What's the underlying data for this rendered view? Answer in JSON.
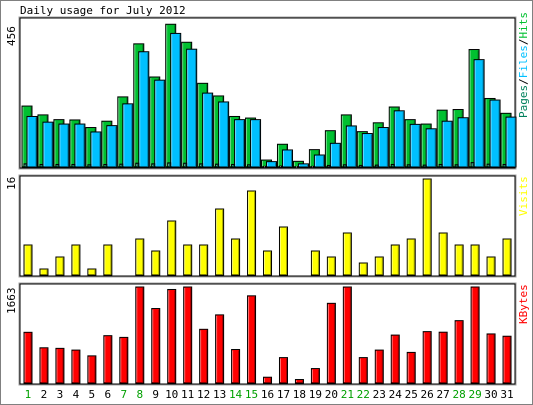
{
  "chart_data": [
    {
      "type": "bar",
      "title": "Daily usage for July 2012",
      "categories": [
        "1",
        "2",
        "3",
        "4",
        "5",
        "6",
        "7",
        "8",
        "9",
        "10",
        "11",
        "12",
        "13",
        "14",
        "15",
        "16",
        "17",
        "18",
        "19",
        "20",
        "21",
        "22",
        "23",
        "24",
        "25",
        "26",
        "27",
        "28",
        "29",
        "30",
        "31"
      ],
      "weekend_days": [
        "1",
        "7",
        "8",
        "14",
        "15",
        "21",
        "22",
        "28",
        "29"
      ],
      "ymax_label": "456",
      "ylim": [
        0,
        456
      ],
      "series": [
        {
          "name": "Pages",
          "color": "#00805c",
          "values": [
            10,
            8,
            8,
            8,
            7,
            8,
            9,
            12,
            10,
            13,
            12,
            10,
            9,
            8,
            7,
            2,
            3,
            1,
            2,
            5,
            7,
            5,
            6,
            8,
            7,
            6,
            8,
            7,
            14,
            9,
            8
          ]
        },
        {
          "name": "Files",
          "color": "#00c0ff",
          "values": [
            160,
            142,
            136,
            136,
            111,
            131,
            200,
            365,
            275,
            423,
            373,
            234,
            206,
            150,
            150,
            17,
            54,
            10,
            38,
            75,
            130,
            106,
            125,
            178,
            135,
            121,
            145,
            156,
            340,
            212,
            158
          ]
        },
        {
          "name": "Hits",
          "color": "#00c030",
          "values": [
            193,
            165,
            150,
            149,
            125,
            145,
            222,
            390,
            285,
            452,
            395,
            265,
            225,
            160,
            155,
            22,
            72,
            18,
            55,
            115,
            165,
            112,
            140,
            190,
            150,
            136,
            180,
            182,
            372,
            217,
            170
          ]
        }
      ]
    },
    {
      "type": "bar",
      "categories": [
        "1",
        "2",
        "3",
        "4",
        "5",
        "6",
        "7",
        "8",
        "9",
        "10",
        "11",
        "12",
        "13",
        "14",
        "15",
        "16",
        "17",
        "18",
        "19",
        "20",
        "21",
        "22",
        "23",
        "24",
        "25",
        "26",
        "27",
        "28",
        "29",
        "30",
        "31"
      ],
      "ymax_label": "16",
      "ylim": [
        0,
        16
      ],
      "series": [
        {
          "name": "Visits",
          "color": "#ffff00",
          "values": [
            5,
            1,
            3,
            5,
            1,
            5,
            0,
            6,
            4,
            9,
            5,
            5,
            11,
            6,
            14,
            4,
            8,
            0,
            4,
            3,
            7,
            2,
            3,
            5,
            6,
            16,
            7,
            5,
            5,
            3,
            6
          ]
        }
      ]
    },
    {
      "type": "bar",
      "categories": [
        "1",
        "2",
        "3",
        "4",
        "5",
        "6",
        "7",
        "8",
        "9",
        "10",
        "11",
        "12",
        "13",
        "14",
        "15",
        "16",
        "17",
        "18",
        "19",
        "20",
        "21",
        "22",
        "23",
        "24",
        "25",
        "26",
        "27",
        "28",
        "29",
        "30",
        "31"
      ],
      "ymax_label": "1663",
      "ylim": [
        0,
        1663
      ],
      "series": [
        {
          "name": "KBytes",
          "color": "#ff0000",
          "values": [
            878,
            610,
            600,
            570,
            470,
            820,
            790,
            1663,
            1290,
            1620,
            1663,
            930,
            1180,
            580,
            1510,
            100,
            440,
            60,
            250,
            1380,
            1663,
            440,
            570,
            830,
            530,
            890,
            880,
            1080,
            1663,
            850,
            810
          ]
        }
      ]
    }
  ]
}
